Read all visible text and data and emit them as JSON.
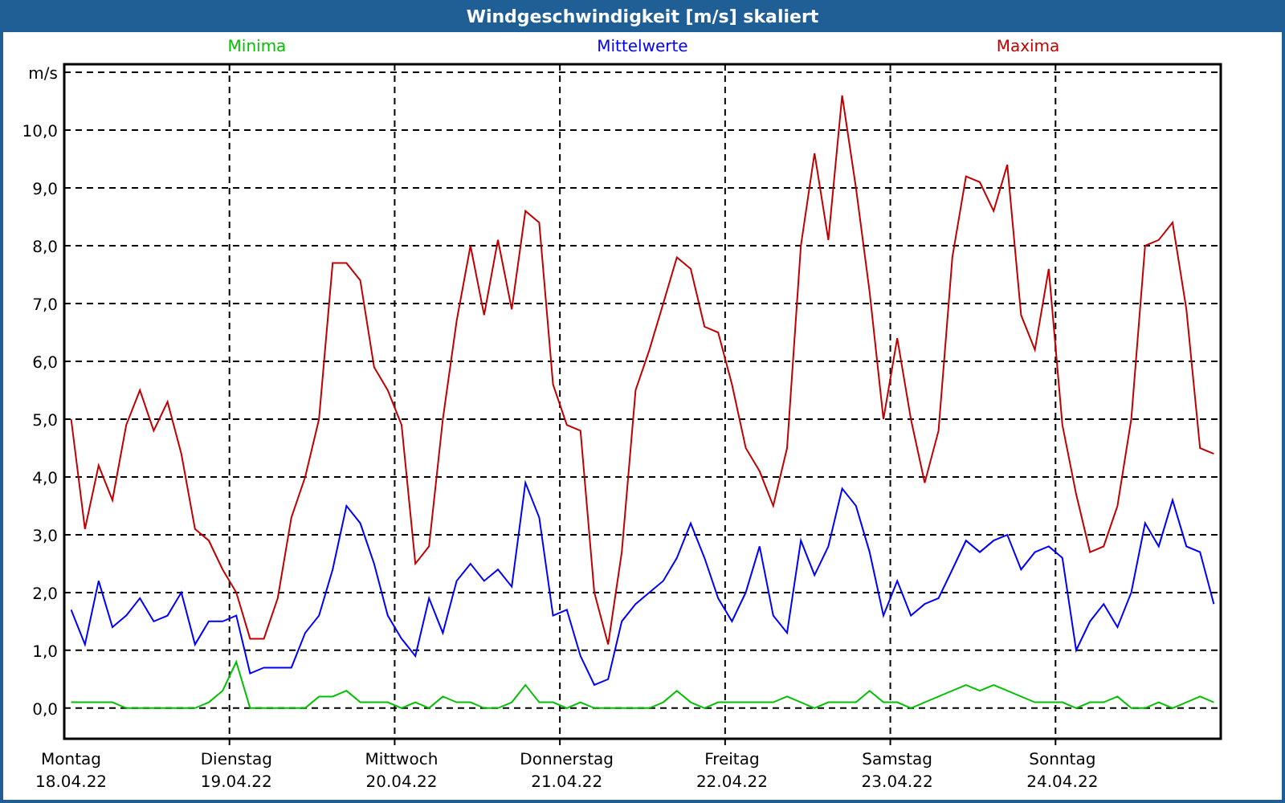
{
  "window": {
    "title": "Windgeschwindigkeit [m/s] skaliert"
  },
  "chart_data": {
    "type": "line",
    "ylabel": "m/s",
    "ylim": [
      -0.53,
      11.14
    ],
    "yticks": [
      {
        "value": 0,
        "label": "0,0"
      },
      {
        "value": 1,
        "label": "1,0"
      },
      {
        "value": 2,
        "label": "2,0"
      },
      {
        "value": 3,
        "label": "3,0"
      },
      {
        "value": 4,
        "label": "4,0"
      },
      {
        "value": 5,
        "label": "5,0"
      },
      {
        "value": 6,
        "label": "6,0"
      },
      {
        "value": 7,
        "label": "7,0"
      },
      {
        "value": 8,
        "label": "8,0"
      },
      {
        "value": 9,
        "label": "9,0"
      },
      {
        "value": 10,
        "label": "10,0"
      }
    ],
    "categories": [
      "Montag\n18.04.22",
      null,
      null,
      null,
      null,
      null,
      null,
      null,
      null,
      null,
      null,
      null,
      "Dienstag\n19.04.22",
      null,
      null,
      null,
      null,
      null,
      null,
      null,
      null,
      null,
      null,
      null,
      "Mittwoch\n20.04.22",
      null,
      null,
      null,
      null,
      null,
      null,
      null,
      null,
      null,
      null,
      null,
      "Donnerstag\n21.04.22",
      null,
      null,
      null,
      null,
      null,
      null,
      null,
      null,
      null,
      null,
      null,
      "Freitag\n22.04.22",
      null,
      null,
      null,
      null,
      null,
      null,
      null,
      null,
      null,
      null,
      null,
      "Samstag\n23.04.22",
      null,
      null,
      null,
      null,
      null,
      null,
      null,
      null,
      null,
      null,
      null,
      "Sonntag\n24.04.22",
      null,
      null,
      null,
      null,
      null,
      null,
      null,
      null,
      null,
      null,
      null
    ],
    "grid": true,
    "series": [
      {
        "name": "Minima",
        "color": "#00c000",
        "values": [
          0.1,
          0.1,
          0.1,
          0.1,
          0,
          0,
          0,
          0,
          0,
          0,
          0.1,
          0.3,
          0.8,
          0,
          0,
          0,
          0,
          0,
          0.2,
          0.2,
          0.3,
          0.1,
          0.1,
          0.1,
          0,
          0.1,
          0,
          0.2,
          0.1,
          0.1,
          0,
          0,
          0.1,
          0.4,
          0.1,
          0.1,
          0,
          0.1,
          0,
          0,
          0,
          0,
          0,
          0.1,
          0.3,
          0.1,
          0,
          0.1,
          0.1,
          0.1,
          0.1,
          0.1,
          0.2,
          0.1,
          0,
          0.1,
          0.1,
          0.1,
          0.3,
          0.1,
          0.1,
          0,
          0.1,
          0.2,
          0.3,
          0.4,
          0.3,
          0.4,
          0.3,
          0.2,
          0.1,
          0.1,
          0.1,
          0,
          0.1,
          0.1,
          0.2,
          0,
          0,
          0.1,
          0,
          0.1,
          0.2,
          0.1
        ]
      },
      {
        "name": "Mittelwerte",
        "color": "#0000ff",
        "values": [
          1.7,
          1.1,
          2.2,
          1.4,
          1.6,
          1.9,
          1.5,
          1.6,
          2.0,
          1.1,
          1.5,
          1.5,
          1.6,
          0.6,
          0.7,
          0.7,
          0.7,
          1.3,
          1.6,
          2.4,
          3.5,
          3.2,
          2.5,
          1.6,
          1.2,
          0.9,
          1.9,
          1.3,
          2.2,
          2.5,
          2.2,
          2.4,
          2.1,
          3.9,
          3.3,
          1.6,
          1.7,
          0.9,
          0.4,
          0.5,
          1.5,
          1.8,
          2.0,
          2.2,
          2.6,
          3.2,
          2.6,
          1.9,
          1.5,
          2.0,
          2.8,
          1.6,
          1.3,
          2.9,
          2.3,
          2.8,
          3.8,
          3.5,
          2.7,
          1.6,
          2.2,
          1.6,
          1.8,
          1.9,
          2.4,
          2.9,
          2.7,
          2.9,
          3.0,
          2.4,
          2.7,
          2.8,
          2.6,
          1.0,
          1.5,
          1.8,
          1.4,
          2.0,
          3.2,
          2.8,
          3.6,
          2.8,
          2.7,
          1.8
        ]
      },
      {
        "name": "Maxima",
        "color": "#c00000",
        "values": [
          5.0,
          3.1,
          4.2,
          3.6,
          4.9,
          5.5,
          4.8,
          5.3,
          4.4,
          3.1,
          2.9,
          2.4,
          2.0,
          1.2,
          1.2,
          1.9,
          3.3,
          4.0,
          5.0,
          7.7,
          7.7,
          7.4,
          5.9,
          5.5,
          4.9,
          2.5,
          2.8,
          5.0,
          6.7,
          8.0,
          6.8,
          8.1,
          6.9,
          8.6,
          8.4,
          5.6,
          4.9,
          4.8,
          2.0,
          1.1,
          2.7,
          5.5,
          6.2,
          7.0,
          7.8,
          7.6,
          6.6,
          6.5,
          5.6,
          4.5,
          4.1,
          3.5,
          4.5,
          8.0,
          9.6,
          8.1,
          10.6,
          9.0,
          7.2,
          5.0,
          6.4,
          5.0,
          3.9,
          4.8,
          7.8,
          9.2,
          9.1,
          8.6,
          9.4,
          6.8,
          6.2,
          7.6,
          4.9,
          3.7,
          2.7,
          2.8,
          3.5,
          5.0,
          8.0,
          8.1,
          8.4,
          6.9,
          4.5,
          4.4
        ]
      }
    ]
  }
}
